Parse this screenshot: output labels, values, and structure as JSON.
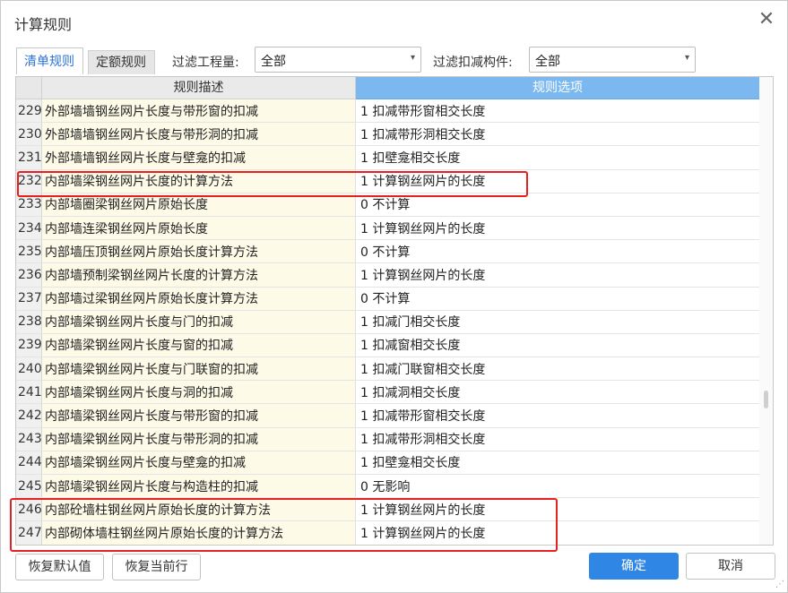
{
  "dialog": {
    "title": "计算规则"
  },
  "tabs": [
    {
      "label": "清单规则",
      "active": true
    },
    {
      "label": "定额规则",
      "active": false
    }
  ],
  "filters": {
    "quantity_label": "过滤工程量:",
    "quantity_value": "全部",
    "component_label": "过滤扣减构件:",
    "component_value": "全部"
  },
  "table": {
    "headers": {
      "desc": "规则描述",
      "option": "规则选项"
    },
    "rows": [
      {
        "idx": "229",
        "desc": "外部墙墙钢丝网片长度与带形窗的扣减",
        "option": "1  扣减带形窗相交长度"
      },
      {
        "idx": "230",
        "desc": "外部墙墙钢丝网片长度与带形洞的扣减",
        "option": "1  扣减带形洞相交长度"
      },
      {
        "idx": "231",
        "desc": "外部墙墙钢丝网片长度与壁龛的扣减",
        "option": "1  扣壁龛相交长度"
      },
      {
        "idx": "232",
        "desc": "内部墙梁钢丝网片长度的计算方法",
        "option": "1  计算钢丝网片的长度"
      },
      {
        "idx": "233",
        "desc": "内部墙圈梁钢丝网片原始长度",
        "option": "0  不计算"
      },
      {
        "idx": "234",
        "desc": "内部墙连梁钢丝网片原始长度",
        "option": "1  计算钢丝网片的长度"
      },
      {
        "idx": "235",
        "desc": "内部墙压顶钢丝网片原始长度计算方法",
        "option": "0  不计算"
      },
      {
        "idx": "236",
        "desc": "内部墙预制梁钢丝网片长度的计算方法",
        "option": "1  计算钢丝网片的长度"
      },
      {
        "idx": "237",
        "desc": "内部墙过梁钢丝网片原始长度计算方法",
        "option": "0  不计算"
      },
      {
        "idx": "238",
        "desc": "内部墙梁钢丝网片长度与门的扣减",
        "option": "1  扣减门相交长度"
      },
      {
        "idx": "239",
        "desc": "内部墙梁钢丝网片长度与窗的扣减",
        "option": "1  扣减窗相交长度"
      },
      {
        "idx": "240",
        "desc": "内部墙梁钢丝网片长度与门联窗的扣减",
        "option": "1  扣减门联窗相交长度"
      },
      {
        "idx": "241",
        "desc": "内部墙梁钢丝网片长度与洞的扣减",
        "option": "1  扣减洞相交长度"
      },
      {
        "idx": "242",
        "desc": "内部墙梁钢丝网片长度与带形窗的扣减",
        "option": "1  扣减带形窗相交长度"
      },
      {
        "idx": "243",
        "desc": "内部墙梁钢丝网片长度与带形洞的扣减",
        "option": "1  扣减带形洞相交长度"
      },
      {
        "idx": "244",
        "desc": "内部墙梁钢丝网片长度与壁龛的扣减",
        "option": "1  扣壁龛相交长度"
      },
      {
        "idx": "245",
        "desc": "内部墙梁钢丝网片长度与构造柱的扣减",
        "option": "0  无影响"
      },
      {
        "idx": "246",
        "desc": "内部砼墙柱钢丝网片原始长度的计算方法",
        "option": "1  计算钢丝网片的长度"
      },
      {
        "idx": "247",
        "desc": "内部砌体墙柱钢丝网片原始长度的计算方法",
        "option": "1  计算钢丝网片的长度"
      }
    ]
  },
  "buttons": {
    "restore_default": "恢复默认值",
    "restore_current": "恢复当前行",
    "ok": "确定",
    "cancel": "取消"
  },
  "colors": {
    "accent": "#2f86e5",
    "header_option_bg": "#7ab8ef",
    "highlight": "#e8201f",
    "desc_bg": "#fdfbe8"
  },
  "icons": {
    "close": "close-icon",
    "dropdown": "chevron-down-icon"
  }
}
